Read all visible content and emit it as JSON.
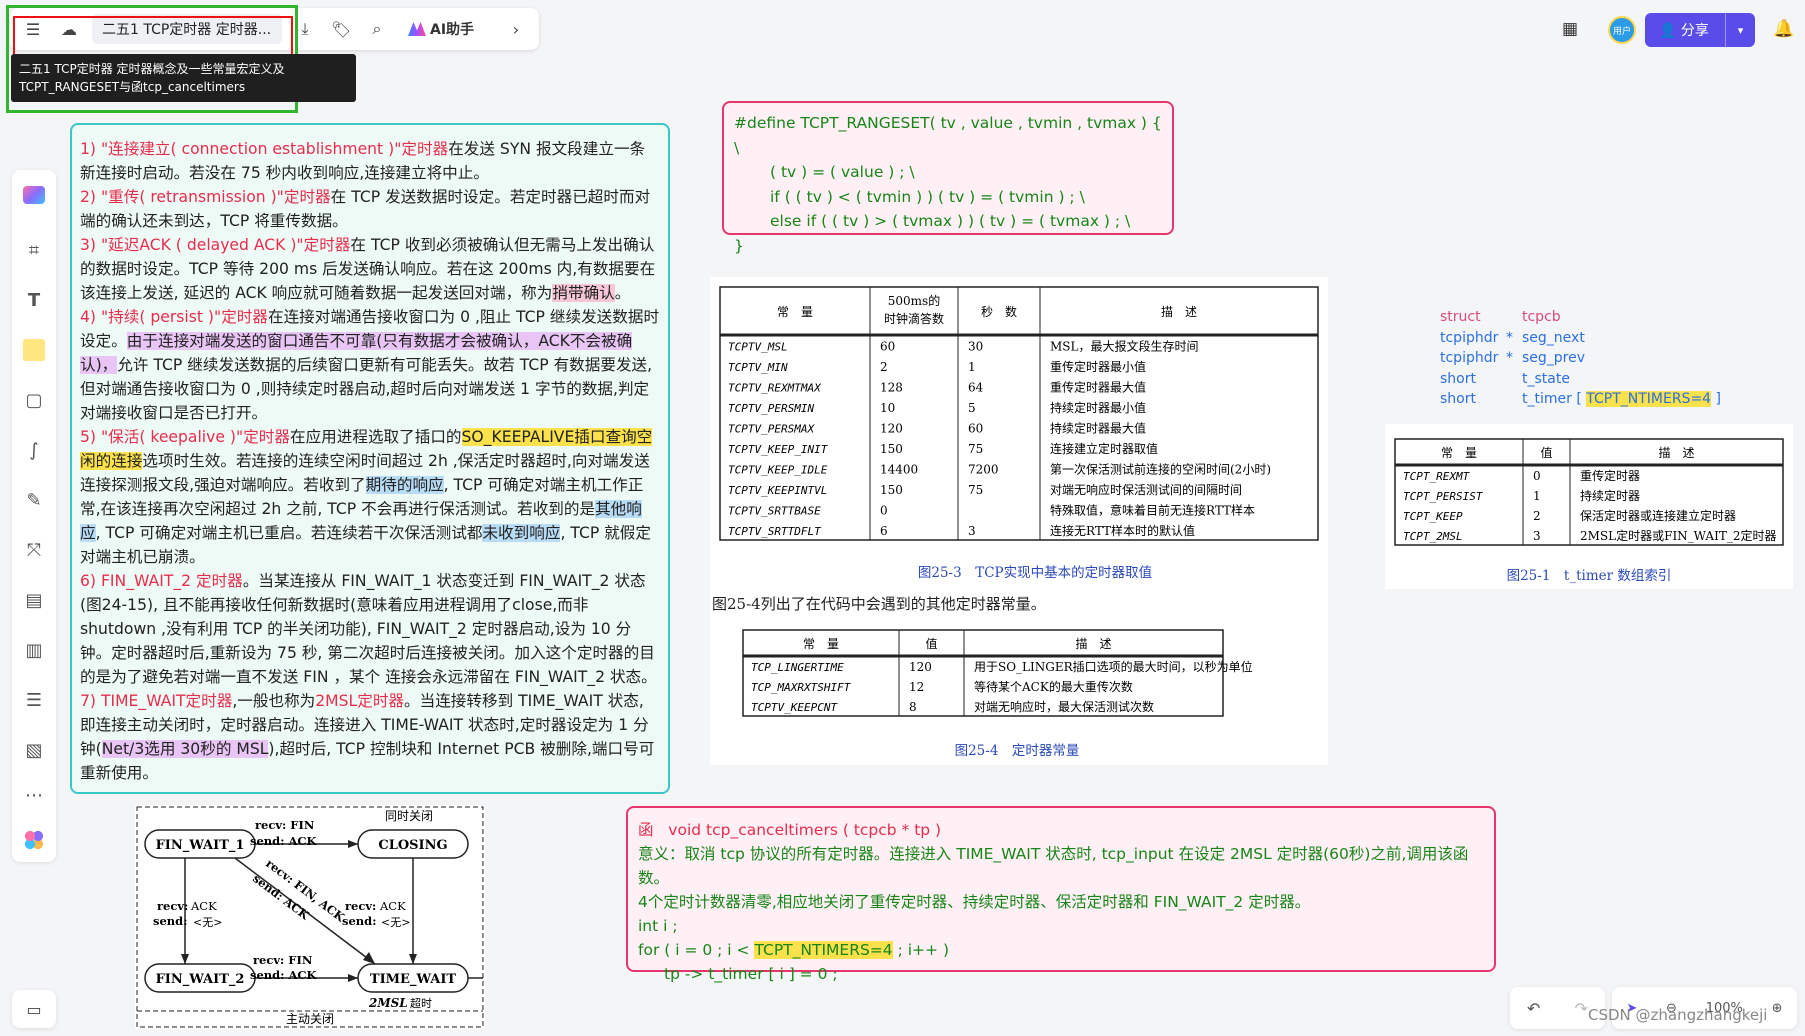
{
  "toolbar": {
    "menu_icon": "menu-icon",
    "title": "二五1 TCP定时器 定时器...",
    "ai_label": "AI助手",
    "tooltip_line1": "二五1 TCP定时器 定时器概念及一些常量宏定义及",
    "tooltip_line2": "TCPT_RANGESET与函tcp_canceltimers"
  },
  "header_right": {
    "avatar_label": "用户",
    "share_label": "分享"
  },
  "notes": {
    "p1a": "1) \"连接建立( connection establishment )\"",
    "p1b": "定时器",
    "p1c": "在发送 SYN 报文段建立一条新连接时启动。若没在 75 秒内收到响应,连接建立将中止。",
    "p2a": "2) \"重传( retransmission )\"",
    "p2b": "定时器",
    "p2c": "在 TCP 发送数据时设定。若定时器已超时而对端的确认还未到达，TCP 将重传数据。",
    "p3a": "3) \"延迟ACK ( delayed ACK )\"",
    "p3b": "定时器",
    "p3c": "在 TCP 收到必须被确认但无需马上发出确认的数据时设定。TCP 等待 200 ms 后发送确认响应。若在这 200ms 内,有数据要在该连接上发送, 延迟的 ACK 响应就可随着数据一起发送回对端，称为",
    "p3hl": "捎带确认",
    "p3d": "。",
    "p4a": "4) \"持续( persist )\"",
    "p4b": "定时器",
    "p4c": "在连接对端通告接收窗口为 0 ,阻止 TCP 继续发送数据时设定。",
    "p4hl": "由于连接对端发送的窗口通告不可靠(只有数据才会被确认，ACK不会被确认)，",
    "p4d": "允许 TCP 继续发送数据的后续窗口更新有可能丢失。故若 TCP 有数据要发送,但对端通告接收窗口为 0 ,则持续定时器启动,超时后向对端发送 1 字节的数据,判定对端接收窗口是否已打开。",
    "p5a": "5) \"保活( keepalive )\"",
    "p5b": "定时器",
    "p5c": "在应用进程选取了插口的",
    "p5hl1": "SO_KEEPALIVE插口查询空闲的连接",
    "p5d": "选项时生效。若连接的连续空闲时间超过 2h ,保活定时器超时,向对端发送连接探测报文段,强迫对端响应。若收到了",
    "p5hl2": "期待的响应",
    "p5e": ", TCP 可确定对端主机工作正常,在该连接再次空闲超过 2h 之前, TCP 不会再进行保活测试。若收到的是",
    "p5hl3": "其他响应",
    "p5f": ", TCP 可确定对端主机已重启。若连续若干次保活测试都",
    "p5hl4": "未收到响应",
    "p5g": ", TCP 就假定对端主机已崩溃。",
    "p6a": "6) FIN_WAIT_2 定时器",
    "p6b": "。当某连接从 FIN_WAIT_1 状态变迁到 FIN_WAIT_2 状态 (图24-15), 且不能再接收任何新数据时(意味着应用进程调用了close,而非 shutdown ,没有利用 TCP 的半关闭功能), FIN_WAIT_2 定时器启动,设为 10 分钟。定时器超时后,重新设为 75 秒, 第二次超时后连接被关闭。加入这个定时器的目的是为了避免若对端一直不发送 FIN ，某个 连接会永远滞留在 FIN_WAIT_2 状态。",
    "p7a": "7) TIME_WAIT定时器",
    "p7b": ",一般也称为",
    "p7c": "2MSL定时器",
    "p7d": "。当连接转移到 TIME_WAIT 状态, 即连接主动关闭时，定时器启动。连接进入 TIME-WAIT 状态时,定时器设定为 1 分钟(",
    "p7hl": "Net/3选用 30秒的 MSL",
    "p7e": "),超时后, TCP 控制块和 Internet PCB 被删除,端口号可重新使用。"
  },
  "define": {
    "l1": "#define  TCPT_RANGESET( tv , value , tvmin , tvmax ) { \\",
    "l2": "( tv ) = ( value ) ; \\",
    "l3": "if ( ( tv ) < ( tvmin ) )      ( tv ) = ( tvmin ) ; \\",
    "l4": "else  if  ( ( tv ) > ( tvmax ) )    ( tv ) = ( tvmax ) ; \\",
    "l5": "}"
  },
  "table1": {
    "headers": [
      "常　量",
      "500ms的\n时钟滴答数",
      "秒　数",
      "描　述"
    ],
    "rows": [
      [
        "TCPTV_MSL",
        "60",
        "30",
        "MSL，最大报文段生存时间"
      ],
      [
        "TCPTV_MIN",
        "2",
        "1",
        "重传定时器最小值"
      ],
      [
        "TCPTV_REXMTMAX",
        "128",
        "64",
        "重传定时器最大值"
      ],
      [
        "TCPTV_PERSMIN",
        "10",
        "5",
        "持续定时器最小值"
      ],
      [
        "TCPTV_PERSMAX",
        "120",
        "60",
        "持续定时器最大值"
      ],
      [
        "TCPTV_KEEP_INIT",
        "150",
        "75",
        "连接建立定时器取值"
      ],
      [
        "TCPTV_KEEP_IDLE",
        "14400",
        "7200",
        "第一次保活测试前连接的空闲时间(2小时)"
      ],
      [
        "TCPTV_KEEPINTVL",
        "150",
        "75",
        "对端无响应时保活测试间的间隔时间"
      ],
      [
        "TCPTV_SRTTBASE",
        "0",
        "",
        "特殊取值，意味着目前无连接RTT样本"
      ],
      [
        "TCPTV_SRTTDFLT",
        "6",
        "3",
        "连接无RTT样本时的默认值"
      ]
    ],
    "caption": "图25-3　TCP实现中基本的定时器取值",
    "intro": "图25-4列出了在代码中会遇到的其他定时器常量。"
  },
  "table2": {
    "headers": [
      "常　量",
      "值",
      "描　述"
    ],
    "rows": [
      [
        "TCP_LINGERTIME",
        "120",
        "用于SO_LINGER插口选项的最大时间，以秒为单位"
      ],
      [
        "TCP_MAXRXTSHIFT",
        "12",
        "等待某个ACK的最大重传次数"
      ],
      [
        "TCPTV_KEEPCNT",
        "8",
        "对端无响应时，最大保活测试次数"
      ]
    ],
    "caption": "图25-4　定时器常量"
  },
  "struct": {
    "rows": [
      [
        "struct",
        "",
        "tcpcb"
      ],
      [
        "tcpiphdr",
        "*",
        "seg_next"
      ],
      [
        "tcpiphdr",
        "*",
        "seg_prev"
      ],
      [
        "short",
        "",
        "t_state"
      ],
      [
        "short",
        "",
        "t_timer [ "
      ]
    ],
    "ntimers": "TCPT_NTIMERS=4",
    "close_bracket": " ]"
  },
  "table3": {
    "headers": [
      "常　量",
      "值",
      "描　述"
    ],
    "rows": [
      [
        "TCPT_REXMT",
        "0",
        "重传定时器"
      ],
      [
        "TCPT_PERSIST",
        "1",
        "持续定时器"
      ],
      [
        "TCPT_KEEP",
        "2",
        "保活定时器或连接建立定时器"
      ],
      [
        "TCPT_2MSL",
        "3",
        "2MSL定时器或FIN_WAIT_2定时器"
      ]
    ],
    "caption": "图25-1　t_timer 数组索引"
  },
  "func": {
    "l1a": "函",
    "l1b": "void  tcp_canceltimers ( tcpcb  * tp  )",
    "l2": "意义：取消 tcp 协议的所有定时器。连接进入 TIME_WAIT 状态时, tcp_input  在设定 2MSL 定时器(60秒)之前,调用该函数。",
    "l3": "4个定时计数器清零,相应地关闭了重传定时器、持续定时器、保活定时器和 FIN_WAIT_2 定时器。",
    "l4": "int   i ;",
    "l5a": "for ( i  =  0  ;  i  <  ",
    "l5hl": "TCPT_NTIMERS=4",
    "l5b": "  ;   i++ )",
    "l6": "tp -> t_timer [ i ] = 0 ;"
  },
  "diagram": {
    "label_simul": "同时关闭",
    "fw1": "FIN_WAIT_1",
    "closing": "CLOSING",
    "fw2": "FIN_WAIT_2",
    "tw": "TIME_WAIT",
    "e1": "recv: FIN",
    "e1b": "send: ACK",
    "e2": "recv: FIN, ACK",
    "e2b": "send: ACK",
    "e3a": "recv:",
    "e3b": "ACK",
    "e3c": "send:",
    "e3d": "<无>",
    "e4a": "recv:",
    "e4b": "ACK",
    "e4c": "send:",
    "e4d": "<无>",
    "e5": "recv: FIN",
    "e5b": "send: ACK",
    "msl": "2MSL",
    "timeout": "超时",
    "label_active": "主动关闭"
  },
  "bottom": {
    "zoom": "100%",
    "watermark": "CSDN @zhangzhangkeji"
  }
}
